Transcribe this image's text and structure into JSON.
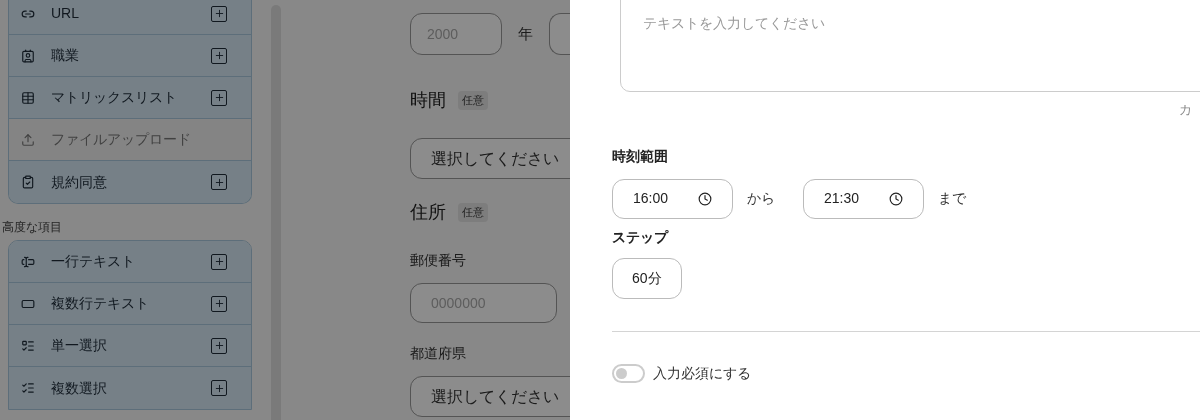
{
  "sidebar": {
    "groups": [
      {
        "items": [
          {
            "label": "URL",
            "disabled": false
          },
          {
            "label": "職業",
            "disabled": false
          },
          {
            "label": "マトリックスリスト",
            "disabled": false
          },
          {
            "label": "ファイルアップロード",
            "disabled": true
          },
          {
            "label": "規約同意",
            "disabled": false
          }
        ]
      },
      {
        "label": "高度な項目",
        "items": [
          {
            "label": "一行テキスト",
            "disabled": false
          },
          {
            "label": "複数行テキスト",
            "disabled": false
          },
          {
            "label": "単一選択",
            "disabled": false
          },
          {
            "label": "複数選択",
            "disabled": false
          }
        ]
      }
    ]
  },
  "form": {
    "year": {
      "placeholder": "2000",
      "unit": "年"
    },
    "sections": [
      {
        "title": "時間",
        "badge": "任意",
        "fields": [
          {
            "kind": "select",
            "placeholder": "選択してください"
          }
        ]
      },
      {
        "title": "住所",
        "badge": "任意",
        "fields": [
          {
            "kind": "input",
            "label": "郵便番号",
            "placeholder": "0000000"
          },
          {
            "kind": "select",
            "label": "都道府県",
            "placeholder": "選択してください"
          }
        ]
      }
    ]
  },
  "drawer": {
    "textarea": {
      "placeholder": "テキストを入力してください"
    },
    "counter": "カ",
    "time_range": {
      "label": "時刻範囲",
      "start": "16:00",
      "from_text": "から",
      "end": "21:30",
      "to_text": "まで"
    },
    "step": {
      "label": "ステップ",
      "value": "60分"
    },
    "required_toggle": {
      "label": "入力必須にする",
      "on": false
    }
  }
}
